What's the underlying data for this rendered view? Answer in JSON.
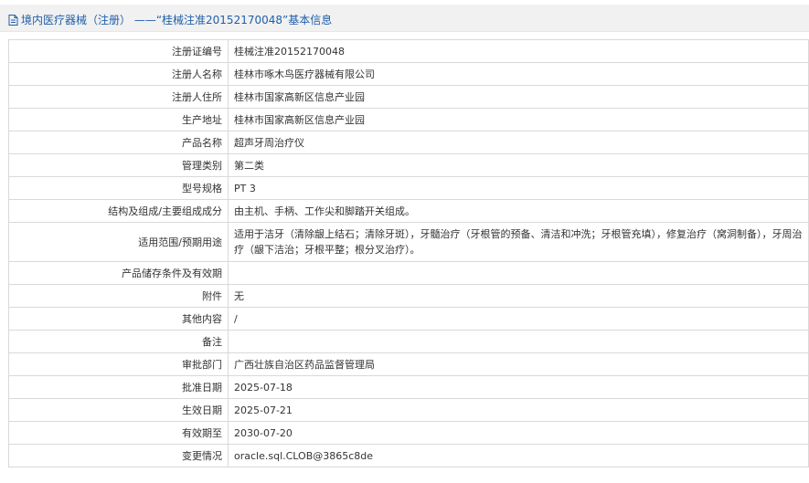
{
  "header": {
    "icon": "document-icon",
    "title": "境内医疗器械（注册） ——“桂械注准20152170048”基本信息"
  },
  "rows": [
    {
      "label": "注册证编号",
      "value": "桂械注准20152170048"
    },
    {
      "label": "注册人名称",
      "value": "桂林市啄木鸟医疗器械有限公司"
    },
    {
      "label": "注册人住所",
      "value": "桂林市国家高新区信息产业园"
    },
    {
      "label": "生产地址",
      "value": "桂林市国家高新区信息产业园"
    },
    {
      "label": "产品名称",
      "value": "超声牙周治疗仪"
    },
    {
      "label": "管理类别",
      "value": "第二类"
    },
    {
      "label": "型号规格",
      "value": "PT 3"
    },
    {
      "label": "结构及组成/主要组成成分",
      "value": "由主机、手柄、工作尖和脚踏开关组成。"
    },
    {
      "label": "适用范围/预期用途",
      "value": "适用于洁牙（清除龈上结石；清除牙斑），牙髓治疗（牙根管的预备、清洁和冲洗；牙根管充填），修复治疗（窝洞制备），牙周治疗（龈下洁治；牙根平整；根分叉治疗）。"
    },
    {
      "label": "产品储存条件及有效期",
      "value": ""
    },
    {
      "label": "附件",
      "value": "无"
    },
    {
      "label": "其他内容",
      "value": "/"
    },
    {
      "label": "备注",
      "value": ""
    },
    {
      "label": "审批部门",
      "value": "广西壮族自治区药品监督管理局"
    },
    {
      "label": "批准日期",
      "value": "2025-07-18"
    },
    {
      "label": "生效日期",
      "value": "2025-07-21"
    },
    {
      "label": "有效期至",
      "value": "2030-07-20"
    },
    {
      "label": "变更情况",
      "value": "oracle.sql.CLOB@3865c8de"
    }
  ],
  "colors": {
    "link": "#1f5fa8",
    "header_bg": "#f1f1f1",
    "border": "#d9d9d9"
  }
}
